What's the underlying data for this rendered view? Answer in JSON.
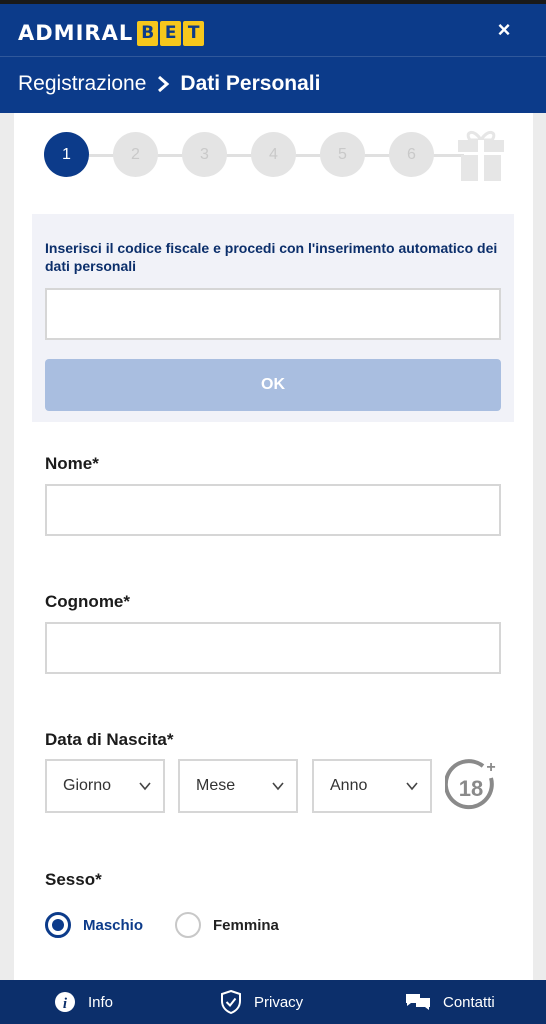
{
  "brand": {
    "name_part1": "ADMIRAL",
    "name_part2": [
      "B",
      "E",
      "T"
    ]
  },
  "header": {
    "close_symbol": "×"
  },
  "breadcrumb": {
    "parent": "Registrazione",
    "current": "Dati Personali"
  },
  "stepper": {
    "steps": [
      "1",
      "2",
      "3",
      "4",
      "5",
      "6"
    ],
    "active_step": 1,
    "final_icon": "gift-icon"
  },
  "codice_fiscale": {
    "label": "Inserisci il codice fiscale e procedi con l'inserimento automatico dei dati personali",
    "value": "",
    "ok_label": "OK"
  },
  "form": {
    "nome_label": "Nome*",
    "nome_value": "",
    "cognome_label": "Cognome*",
    "cognome_value": "",
    "nascita_label": "Data di Nascita*",
    "giorno": "Giorno",
    "mese": "Mese",
    "anno": "Anno",
    "age_badge": "18+",
    "sesso_label": "Sesso*",
    "sesso_options": [
      "Maschio",
      "Femmina"
    ],
    "sesso_selected": "Maschio"
  },
  "footer": {
    "items": [
      "Info",
      "Privacy",
      "Contatti"
    ]
  },
  "colors": {
    "primary": "#0c3b8a",
    "accent_yellow": "#f6c71c",
    "ok_disabled": "#a9bee0",
    "footer": "#0c2f6b"
  }
}
